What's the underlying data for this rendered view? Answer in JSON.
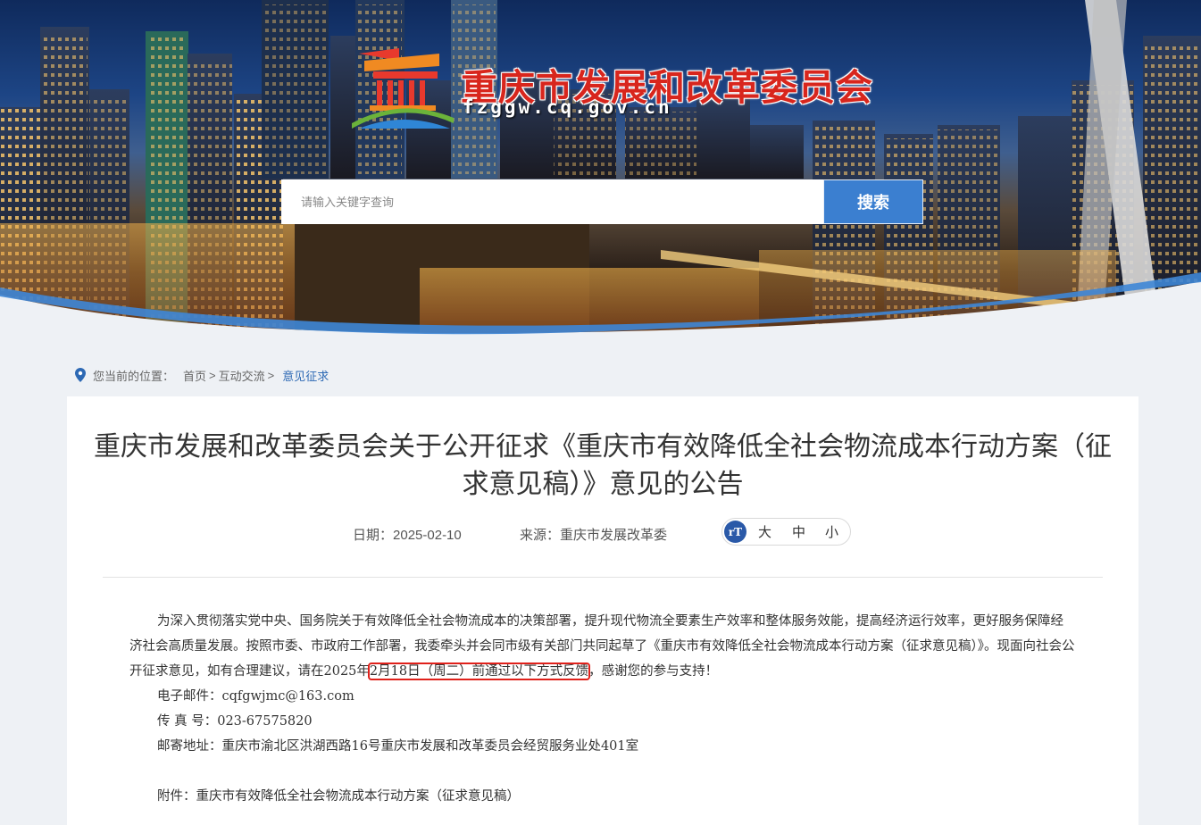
{
  "site": {
    "title": "重庆市发展和改革委员会",
    "domain": "fzggw.cq.gov.cn"
  },
  "search": {
    "placeholder": "请输入关键字查询",
    "button_label": "搜索"
  },
  "breadcrumb": {
    "prefix": "您当前的位置：",
    "items": [
      "首页",
      "互动交流",
      "意见征求"
    ],
    "separator": ">"
  },
  "article": {
    "title": "重庆市发展和改革委员会关于公开征求《重庆市有效降低全社会物流成本行动方案（征求意见稿）》意见的公告",
    "date_label": "日期：",
    "date": "2025-02-10",
    "source_label": "来源：",
    "source": "重庆市发展改革委",
    "font_size": {
      "icon_text": "rT",
      "large": "大",
      "medium": "中",
      "small": "小"
    },
    "paragraph_before": "为深入贯彻落实党中央、国务院关于有效降低全社会物流成本的决策部署，提升现代物流全要素生产效率和整体服务效能，提高经济运行效率，更好服务保障经济社会高质量发展。按照市委、市政府工作部署，我委牵头并会同市级有关部门共同起草了《重庆市有效降低全社会物流成本行动方案（征求意见稿）》。现面向社会公开征求意见，如有合理建议，请在2025年",
    "paragraph_highlight": "2月18日（周二）前通过以下方式反馈",
    "paragraph_after": "，感谢您的参与支持！",
    "email": "电子邮件：cqfgwjmc@163.com",
    "fax": "传 真 号：023-67575820",
    "address": "邮寄地址：重庆市渝北区洪湖西路16号重庆市发展和改革委员会经贸服务业处401室",
    "attachment": "附件：重庆市有效降低全社会物流成本行动方案（征求意见稿）"
  },
  "colors": {
    "site_title": "#d8261d",
    "search_button": "#3b7fd0",
    "breadcrumb_current": "#2d69b4",
    "highlight_border": "#e0211b"
  }
}
